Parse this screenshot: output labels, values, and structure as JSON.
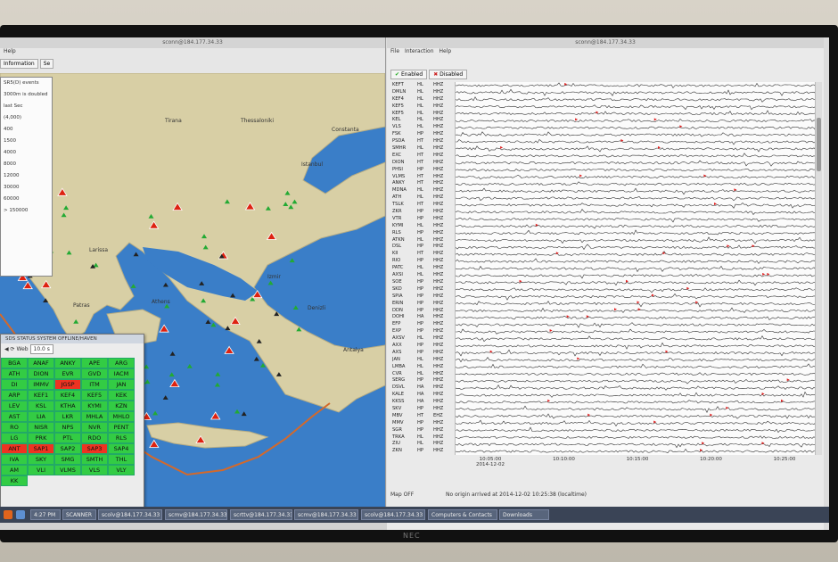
{
  "colors": {
    "station_ok": "#33cc44",
    "station_alert": "#ee3322",
    "triangle_red": "#dd2211",
    "triangle_green": "#22aa33",
    "sea": "#3a7ec8",
    "land": "#d8cfa5",
    "fault": "#d4692a"
  },
  "left_window": {
    "title": "sconn@184.177.34.33",
    "menu": [
      "Help"
    ],
    "tabs": [
      "Information",
      "Se"
    ],
    "status": "",
    "legend": {
      "title": "SR5(D) events",
      "rows": [
        "3000m is doubled",
        "last Sec",
        "(4,000)",
        "400",
        "1500",
        "4000",
        "8000",
        "12000",
        "30000",
        "60000",
        "> 150000"
      ]
    },
    "places": [
      "Tirana",
      "Thessaloniki",
      "Istanbul",
      "Constanta",
      "Izmir",
      "Denizli",
      "Antalya",
      "Larissa",
      "Patras",
      "Athens"
    ]
  },
  "station_grid": {
    "title": "SDS STATUS SYSTEM OFFLINE/HAVEN",
    "tool_label": "Web",
    "zoom": "10.0 s",
    "stations": [
      "BGA",
      "ANAF",
      "ANKY",
      "APE",
      "ARG",
      "ATH",
      "DION",
      "EVR",
      "GVD",
      "IACM",
      "DI",
      "IMMV",
      "JGSP",
      "ITM",
      "JAN",
      "ARP",
      "KEF1",
      "KEF4",
      "KEF5",
      "KEK",
      "LEV",
      "KSL",
      "KTHA",
      "KYMI",
      "KZN",
      "AST",
      "LIA",
      "LKR",
      "MHLA",
      "MHLO",
      "RO",
      "NISR",
      "NPS",
      "NVR",
      "PENT",
      "LG",
      "PRK",
      "PTL",
      "RDO",
      "RLS",
      "ANT",
      "SAP1",
      "SAP2",
      "SAP3",
      "SAP4",
      "IVA",
      "SKY",
      "SMG",
      "SMTH",
      "THL",
      "AM",
      "VLI",
      "VLMS",
      "VLS",
      "VLY",
      "KK"
    ],
    "status": [
      "ok",
      "ok",
      "ok",
      "ok",
      "ok",
      "ok",
      "ok",
      "ok",
      "ok",
      "ok",
      "ok",
      "ok",
      "alert",
      "ok",
      "ok",
      "ok",
      "ok",
      "ok",
      "ok",
      "ok",
      "ok",
      "ok",
      "ok",
      "ok",
      "ok",
      "ok",
      "ok",
      "ok",
      "ok",
      "ok",
      "ok",
      "ok",
      "ok",
      "ok",
      "ok",
      "ok",
      "ok",
      "ok",
      "ok",
      "ok",
      "alert",
      "alert",
      "ok",
      "alert",
      "ok",
      "ok",
      "ok",
      "ok",
      "ok",
      "ok",
      "ok",
      "ok",
      "ok",
      "ok",
      "ok",
      "ok"
    ]
  },
  "right_window": {
    "title": "sconn@184.177.34.33",
    "menu": [
      "File",
      "Interaction",
      "Help"
    ],
    "tabs": [
      "Enabled",
      "Disabled"
    ],
    "stations": [
      [
        "KEFT",
        "HL",
        "HHZ"
      ],
      [
        "DMLN",
        "HL",
        "HHZ"
      ],
      [
        "KEF4",
        "HL",
        "HHZ"
      ],
      [
        "KEF5",
        "HL",
        "HHZ"
      ],
      [
        "KEF5",
        "HL",
        "HHZ"
      ],
      [
        "KEL",
        "HL",
        "HHZ"
      ],
      [
        "VLS",
        "HL",
        "HHZ"
      ],
      [
        "FSK",
        "HP",
        "HHZ"
      ],
      [
        "PSDA",
        "HT",
        "HHZ"
      ],
      [
        "SMHR",
        "HL",
        "HHZ"
      ],
      [
        "EXC",
        "HT",
        "HHZ"
      ],
      [
        "DION",
        "HT",
        "HHZ"
      ],
      [
        "PHSI",
        "HP",
        "HHZ"
      ],
      [
        "VLMS",
        "HT",
        "HHZ"
      ],
      [
        "ANKY",
        "HT",
        "HHZ"
      ],
      [
        "MDNA",
        "HL",
        "HHZ"
      ],
      [
        "ATH",
        "HL",
        "HHZ"
      ],
      [
        "TSLK",
        "HT",
        "HHZ"
      ],
      [
        "ZKR",
        "HP",
        "HHZ"
      ],
      [
        "VTR",
        "HP",
        "HHZ"
      ],
      [
        "KYMI",
        "HL",
        "HHZ"
      ],
      [
        "RLS",
        "HP",
        "HHZ"
      ],
      [
        "ATKN",
        "HL",
        "HHZ"
      ],
      [
        "DSL",
        "HP",
        "HHZ"
      ],
      [
        "KII",
        "HT",
        "HHZ"
      ],
      [
        "RIO",
        "HP",
        "HHZ"
      ],
      [
        "PATC",
        "HL",
        "HHZ"
      ],
      [
        "AXSI",
        "HL",
        "HHZ"
      ],
      [
        "SOE",
        "HP",
        "HHZ"
      ],
      [
        "SKD",
        "HP",
        "HHZ"
      ],
      [
        "SPIA",
        "HP",
        "HHZ"
      ],
      [
        "ERIN",
        "HP",
        "HHZ"
      ],
      [
        "DDN",
        "HP",
        "HHZ"
      ],
      [
        "DOHI",
        "HA",
        "HHZ"
      ],
      [
        "EFP",
        "HP",
        "HHZ"
      ],
      [
        "EXP",
        "HP",
        "HHZ"
      ],
      [
        "AXSV",
        "HL",
        "HHZ"
      ],
      [
        "AXX",
        "HP",
        "HHZ"
      ],
      [
        "AXS",
        "HP",
        "HHZ"
      ],
      [
        "JAN",
        "HL",
        "HHZ"
      ],
      [
        "LMBA",
        "HL",
        "HHZ"
      ],
      [
        "CVR",
        "HL",
        "HHZ"
      ],
      [
        "SERG",
        "HP",
        "HHZ"
      ],
      [
        "DSVL",
        "HA",
        "HHZ"
      ],
      [
        "KALE",
        "HA",
        "HHZ"
      ],
      [
        "KKSS",
        "HA",
        "HHZ"
      ],
      [
        "SKV",
        "HP",
        "HHZ"
      ],
      [
        "MBV",
        "HT",
        "EHZ"
      ],
      [
        "MMV",
        "HP",
        "HHZ"
      ],
      [
        "SGR",
        "HP",
        "HHZ"
      ],
      [
        "TRKA",
        "HL",
        "HHZ"
      ],
      [
        "ZIU",
        "HL",
        "HHZ"
      ],
      [
        "ZKN",
        "HP",
        "HHZ"
      ]
    ],
    "time_ticks": [
      {
        "t": "10:05:00",
        "sub": "2014-12-02"
      },
      {
        "t": "10:10:00",
        "sub": ""
      },
      {
        "t": "10:15:00",
        "sub": ""
      },
      {
        "t": "10:20:00",
        "sub": ""
      },
      {
        "t": "10:25:00",
        "sub": ""
      }
    ],
    "status_left": "Map OFF",
    "status_center": "No origin arrived at 2014-12-02 10:25:38 (localtime)"
  },
  "taskbar": {
    "items": [
      "4:27 PM",
      "SCANNER",
      "scolv@184.177.34.33",
      "scmv@184.177.34.33",
      "scrttv@184.177.34.33",
      "scmv@184.177.34.33",
      "scolv@184.177.34.33",
      "Computers & Contacts",
      "Downloads"
    ]
  }
}
